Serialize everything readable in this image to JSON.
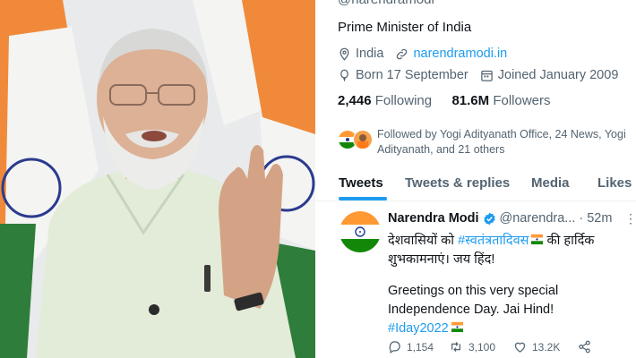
{
  "profile": {
    "handle_partial": "@narendramodi",
    "bio": "Prime Minister of India",
    "location": "India",
    "website": "narendramodi.in",
    "born": "Born 17 September",
    "joined": "Joined January 2009",
    "following_count": "2,446",
    "following_label": "Following",
    "followers_count": "81.6M",
    "followers_label": "Followers",
    "followed_by": "Followed by Yogi Adityanath Office, 24 News, Yogi Adityanath, and 21 others"
  },
  "tabs": [
    {
      "label": "Tweets"
    },
    {
      "label": "Tweets & replies"
    },
    {
      "label": "Media"
    },
    {
      "label": "Likes"
    }
  ],
  "tweet": {
    "name": "Narendra Modi",
    "username": "@narendra...",
    "separator": "·",
    "time": "52m",
    "more": "⋮",
    "line1_prefix": "देशवासियों को ",
    "line1_hashtag": "#स्वतंत्रतादिवस",
    "line1_suffix": " की हार्दिक",
    "line2": "शुभकामनाएं। जय हिंद!",
    "line3": "Greetings on this very special",
    "line4": "Independence Day. Jai Hind!",
    "hashtag2": "#Iday2022",
    "replies": "1,154",
    "retweets": "3,100",
    "likes": "13.2K"
  },
  "icons": {
    "location": "location-pin-icon",
    "link": "link-icon",
    "birthday": "balloon-icon",
    "calendar": "calendar-icon",
    "verified": "verified-badge-icon",
    "reply": "reply-icon",
    "retweet": "retweet-icon",
    "like": "heart-icon",
    "share": "share-icon"
  },
  "colors": {
    "accent": "#1d9bf0",
    "text": "#0f1419",
    "muted": "#536471",
    "saffron": "#ff9933",
    "green": "#138808"
  }
}
